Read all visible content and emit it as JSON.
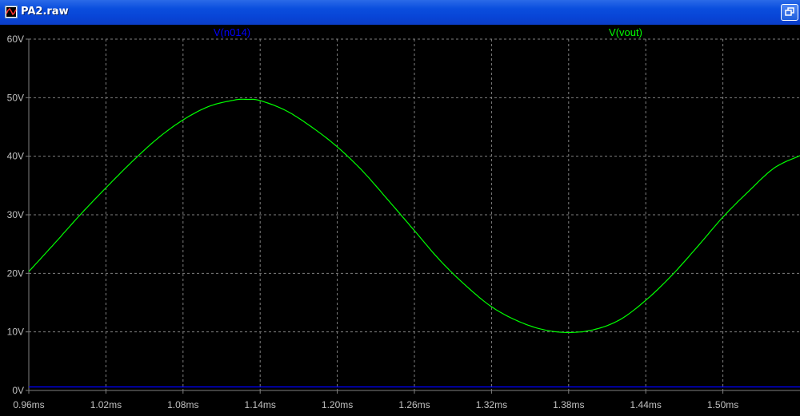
{
  "window": {
    "title": "PA2.raw",
    "title_icon": "waveform-plot-icon",
    "control_icon": "restore-window-icon"
  },
  "colors": {
    "background": "#000000",
    "grid": "#808080",
    "axis_text": "#c0c0c0",
    "trace_n014": "#0000ff",
    "trace_vout": "#00ff00"
  },
  "chart_data": {
    "type": "line",
    "traces": [
      {
        "name": "V(n014)",
        "color": "#0000ff"
      },
      {
        "name": "V(vout)",
        "color": "#00ff00"
      }
    ],
    "x_unit": "ms",
    "y_unit": "V",
    "xlim": [
      0.96,
      1.56
    ],
    "ylim": [
      0,
      60
    ],
    "x_ticks": [
      0.96,
      1.02,
      1.08,
      1.14,
      1.2,
      1.26,
      1.32,
      1.38,
      1.44,
      1.5
    ],
    "x_tick_labels": [
      "0.96ms",
      "1.02ms",
      "1.08ms",
      "1.14ms",
      "1.20ms",
      "1.26ms",
      "1.32ms",
      "1.38ms",
      "1.44ms",
      "1.50ms"
    ],
    "y_ticks": [
      0,
      10,
      20,
      30,
      40,
      50,
      60
    ],
    "y_tick_labels": [
      "0V",
      "10V",
      "20V",
      "30V",
      "40V",
      "50V",
      "60V"
    ],
    "grid": true,
    "series": [
      {
        "name": "V(n014)",
        "x": [
          0.96,
          1.56
        ],
        "y": [
          0.6,
          0.6
        ]
      },
      {
        "name": "V(vout)",
        "x": [
          0.96,
          0.98,
          1.0,
          1.02,
          1.04,
          1.06,
          1.08,
          1.1,
          1.12,
          1.13,
          1.14,
          1.16,
          1.18,
          1.2,
          1.22,
          1.24,
          1.26,
          1.28,
          1.3,
          1.32,
          1.34,
          1.36,
          1.38,
          1.4,
          1.42,
          1.44,
          1.46,
          1.48,
          1.5,
          1.52,
          1.54,
          1.56
        ],
        "y": [
          20.3,
          25.1,
          30.0,
          34.6,
          39.0,
          43.0,
          46.2,
          48.5,
          49.6,
          49.7,
          49.5,
          47.8,
          45.0,
          41.6,
          37.4,
          32.4,
          27.3,
          22.2,
          17.9,
          14.3,
          11.9,
          10.4,
          9.9,
          10.4,
          12.1,
          15.4,
          19.6,
          24.5,
          29.6,
          34.0,
          38.0,
          40.1
        ]
      }
    ]
  }
}
